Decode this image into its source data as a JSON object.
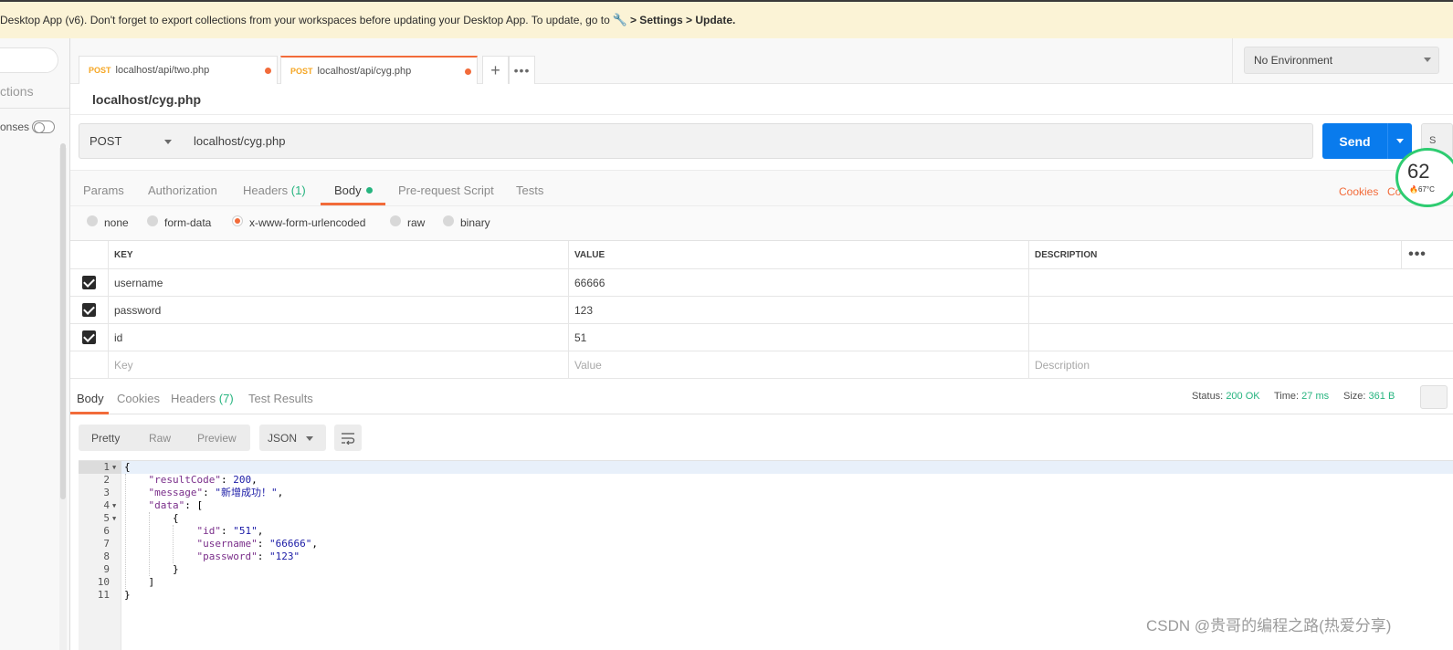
{
  "banner": {
    "text": "Desktop App (v6). Don't forget to export collections from your workspaces before updating your Desktop App. To update, go to",
    "bold": "> Settings > Update."
  },
  "sidebar": {
    "collections_label": "ctions",
    "responses_label": "onses"
  },
  "tabs": [
    {
      "method": "POST",
      "url": "localhost/api/two.php"
    },
    {
      "method": "POST",
      "url": "localhost/api/cyg.php"
    }
  ],
  "environment": {
    "selected": "No Environment"
  },
  "request": {
    "name": "localhost/cyg.php",
    "method": "POST",
    "url": "localhost/cyg.php",
    "send_label": "Send",
    "save_label": "S"
  },
  "request_tabs": {
    "params": "Params",
    "authorization": "Authorization",
    "headers": "Headers",
    "headers_count": "(1)",
    "body": "Body",
    "pre_request": "Pre-request Script",
    "tests": "Tests",
    "cookies": "Cookies",
    "code": "Co"
  },
  "body_types": {
    "none": "none",
    "form_data": "form-data",
    "urlencoded": "x-www-form-urlencoded",
    "raw": "raw",
    "binary": "binary"
  },
  "kv_table": {
    "headers": {
      "key": "KEY",
      "value": "VALUE",
      "description": "DESCRIPTION"
    },
    "rows": [
      {
        "key": "username",
        "value": "66666",
        "description": ""
      },
      {
        "key": "password",
        "value": "123",
        "description": ""
      },
      {
        "key": "id",
        "value": "51",
        "description": ""
      }
    ],
    "placeholder": {
      "key": "Key",
      "value": "Value",
      "description": "Description"
    }
  },
  "response": {
    "tabs": {
      "body": "Body",
      "cookies": "Cookies",
      "headers": "Headers",
      "headers_count": "(7)",
      "test_results": "Test Results"
    },
    "status_label": "Status:",
    "status_value": "200 OK",
    "time_label": "Time:",
    "time_value": "27 ms",
    "size_label": "Size:",
    "size_value": "361 B",
    "formats": {
      "pretty": "Pretty",
      "raw": "Raw",
      "preview": "Preview"
    },
    "language": "JSON"
  },
  "code": {
    "line_numbers": [
      "1",
      "2",
      "3",
      "4",
      "5",
      "6",
      "7",
      "8",
      "9",
      "10",
      "11"
    ]
  },
  "perf_widget": {
    "value": "62",
    "temp": "67°C"
  },
  "watermark": "CSDN @贵哥的编程之路(热爱分享)"
}
